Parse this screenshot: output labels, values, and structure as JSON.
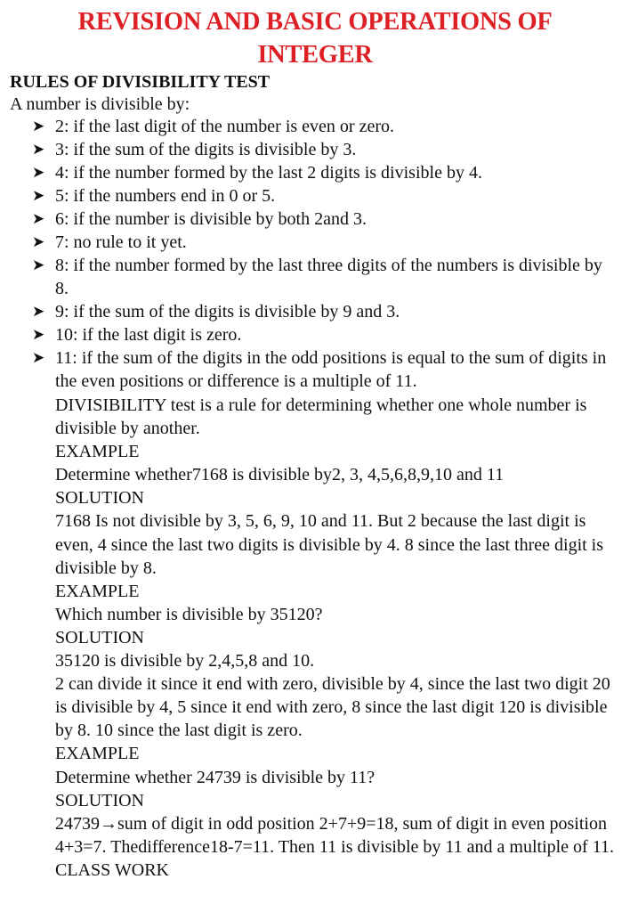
{
  "document": {
    "title_line1": "REVISION AND BASIC OPERATIONS OF",
    "title_line2": "INTEGER",
    "title_color": "#dd1f26",
    "heading": "RULES OF DIVISIBILITY TEST",
    "intro": "A number is divisible by:",
    "bullet_icon": "arrowhead-bullet",
    "rules": [
      "2: if the last digit of the number is even or zero.",
      "3: if the sum of the digits is divisible by 3.",
      "4: if the number formed by the last 2 digits is divisible by 4.",
      "5: if the numbers end in 0 or 5.",
      "6: if the number is divisible by both 2and 3.",
      "7: no rule to it yet.",
      "8: if the number formed by the last three digits of the numbers is divisible by 8.",
      "9: if the sum of the digits is divisible by 9 and 3.",
      "10: if the last digit is zero.",
      "11: if the sum of the digits in the odd positions is equal to the sum of digits in the even positions or difference is a multiple of 11."
    ],
    "definition": "DIVISIBILITY test is a rule for determining whether one whole number is divisible by another.",
    "examples": [
      {
        "example_label": "EXAMPLE",
        "question": "Determine whether7168 is divisible by2, 3, 4,5,6,8,9,10 and 11",
        "solution_label": "SOLUTION",
        "solution": [
          "7168 Is not divisible by 3, 5, 6, 9, 10 and 11. But 2 because the last digit is even, 4 since the last two digits is divisible by 4. 8 since the last three digit is divisible by 8."
        ]
      },
      {
        "example_label": "EXAMPLE",
        "question": "Which number is divisible by 35120?",
        "solution_label": "SOLUTION",
        "solution": [
          "35120 is divisible by 2,4,5,8 and 10.",
          "2 can divide it since it end with zero, divisible by 4, since the last two digit 20 is divisible by 4, 5 since it end with zero, 8 since the last digit 120 is divisible by 8. 10 since the last digit is zero."
        ]
      },
      {
        "example_label": "EXAMPLE",
        "question": "Determine whether 24739 is divisible by 11?",
        "solution_label": "SOLUTION",
        "solution": [
          "24739→sum of digit in odd position 2+7+9=18, sum of digit in even position 4+3=7. Thedifference18-7=11. Then 11 is divisible by 11 and a multiple of 11."
        ]
      }
    ],
    "closing": "CLASS WORK"
  }
}
